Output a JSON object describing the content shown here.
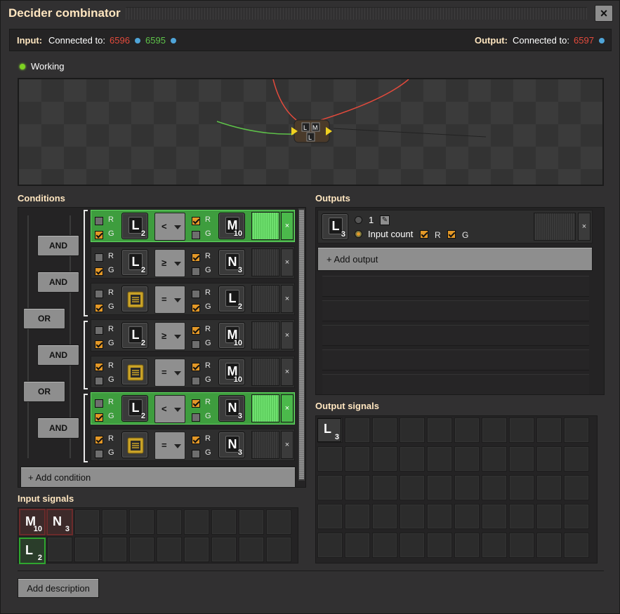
{
  "window": {
    "title": "Decider combinator",
    "close": "×"
  },
  "connections": {
    "input_label": "Input:",
    "input_connected": "Connected to:",
    "input_red": "6596",
    "input_green": "6595",
    "output_label": "Output:",
    "output_connected": "Connected to:",
    "output_red": "6597"
  },
  "status": "Working",
  "sections": {
    "conditions": "Conditions",
    "outputs": "Outputs",
    "input_signals": "Input signals",
    "output_signals": "Output signals"
  },
  "logic": {
    "and": "AND",
    "or": "OR"
  },
  "conditions": [
    {
      "left": "L",
      "left_val": "2",
      "op": "<",
      "right": "M",
      "right_val": "10"
    },
    {
      "left": "L",
      "left_val": "2",
      "op": "≥",
      "right": "N",
      "right_val": "3"
    },
    {
      "left": "chip",
      "left_val": "",
      "op": "=",
      "right": "L",
      "right_val": "2"
    },
    {
      "left": "L",
      "left_val": "2",
      "op": "≥",
      "right": "M",
      "right_val": "10"
    },
    {
      "left": "chip",
      "left_val": "",
      "op": "=",
      "right": "M",
      "right_val": "10"
    },
    {
      "left": "L",
      "left_val": "2",
      "op": "<",
      "right": "N",
      "right_val": "3"
    },
    {
      "left": "chip",
      "left_val": "",
      "op": "=",
      "right": "N",
      "right_val": "3"
    }
  ],
  "labels": {
    "r": "R",
    "g": "G",
    "x": "×"
  },
  "add_condition": "+ Add condition",
  "output": {
    "signal": "L",
    "signal_val": "3",
    "constant": "1",
    "input_count": "Input count",
    "add_output": "+ Add output"
  },
  "input_signals": [
    {
      "letter": "M",
      "value": "10",
      "wire": "red"
    },
    {
      "letter": "N",
      "value": "3",
      "wire": "red"
    },
    {
      "letter": "L",
      "value": "2",
      "wire": "green"
    }
  ],
  "output_signals": [
    {
      "letter": "L",
      "value": "3"
    }
  ],
  "add_description": "Add description",
  "colors": {
    "red_wire": "#e34a3c",
    "green_wire": "#5ec249",
    "checkbox_on": "#e39827",
    "active_row": "#3e9d3e"
  }
}
